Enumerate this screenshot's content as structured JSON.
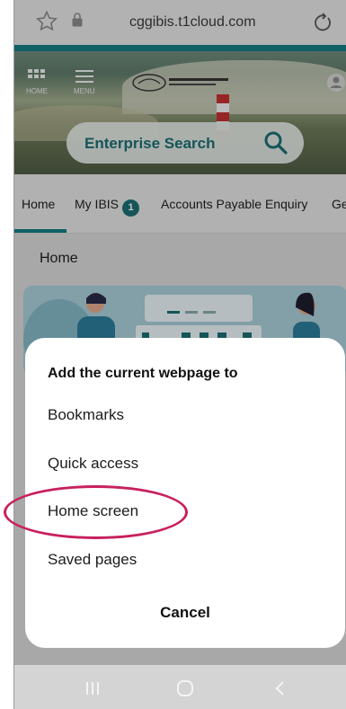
{
  "browser": {
    "url": "cggibis.t1cloud.com"
  },
  "hero": {
    "search_label": "Enterprise Search",
    "grid_label": "HOME",
    "menu_label": "MENU"
  },
  "tabs": [
    {
      "label": "Home",
      "active": true
    },
    {
      "label": "My IBIS",
      "badge": "1"
    },
    {
      "label": "Accounts Payable Enquiry"
    },
    {
      "label": "Ge"
    }
  ],
  "breadcrumb": "Home",
  "sheet": {
    "title": "Add the current webpage to",
    "options": [
      "Bookmarks",
      "Quick access",
      "Home screen",
      "Saved pages"
    ],
    "cancel": "Cancel",
    "highlighted": "Home screen"
  },
  "colors": {
    "accent": "#157c80",
    "highlight_ring": "#c8215d"
  }
}
